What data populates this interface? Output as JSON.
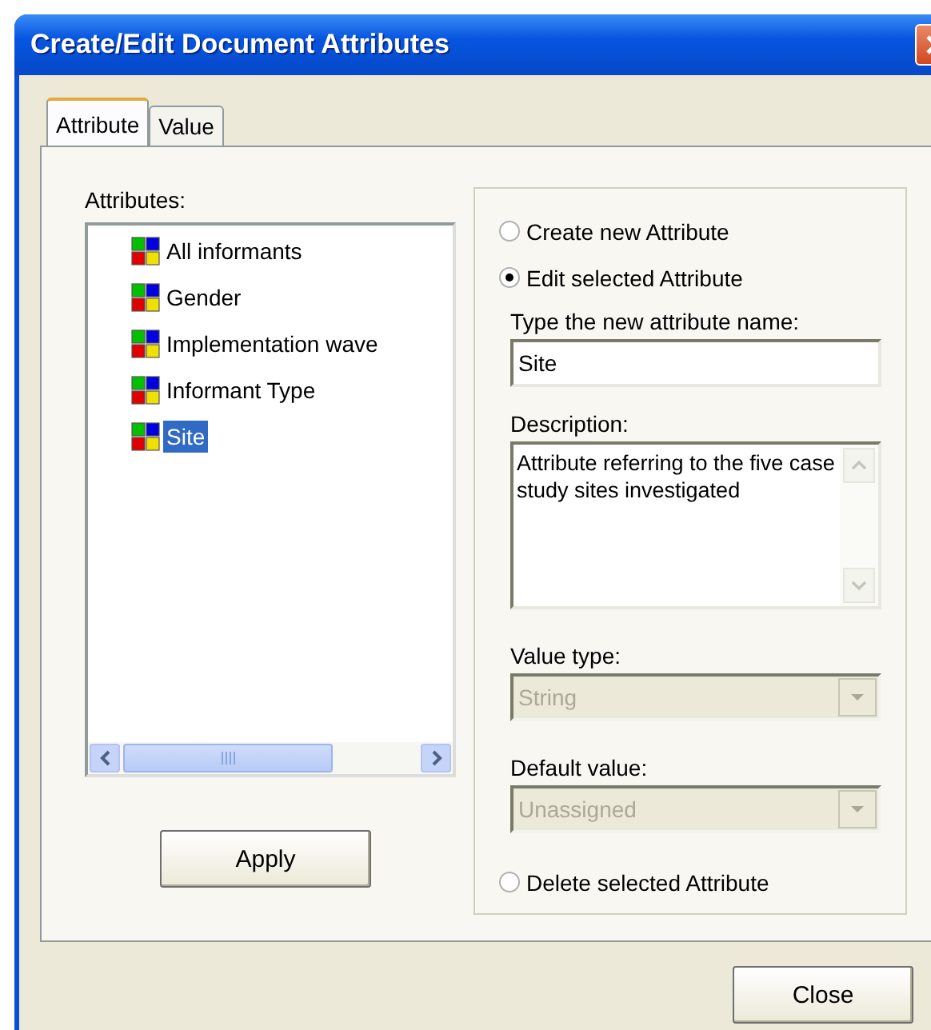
{
  "window": {
    "title": "Create/Edit Document Attributes"
  },
  "tabs": [
    {
      "label": "Attribute",
      "selected": true
    },
    {
      "label": "Value",
      "selected": false
    }
  ],
  "attributes_label": "Attributes:",
  "attributes": [
    {
      "name": "All informants",
      "selected": false
    },
    {
      "name": "Gender",
      "selected": false
    },
    {
      "name": "Implementation wave",
      "selected": false
    },
    {
      "name": "Informant Type",
      "selected": false
    },
    {
      "name": "Site",
      "selected": true
    }
  ],
  "apply_button": "Apply",
  "mode_options": [
    {
      "label": "Create new Attribute",
      "selected": false
    },
    {
      "label": "Edit selected Attribute",
      "selected": true
    }
  ],
  "name_field": {
    "label": "Type the new attribute name:",
    "value": "Site"
  },
  "description": {
    "label": "Description:",
    "value": "Attribute referring to the five case study sites investigated"
  },
  "value_type": {
    "label": "Value type:",
    "value": "String",
    "disabled": true
  },
  "default_value": {
    "label": "Default value:",
    "value": "Unassigned",
    "disabled": true
  },
  "delete_option": {
    "label": "Delete selected Attribute",
    "selected": false
  },
  "close_button": "Close"
}
